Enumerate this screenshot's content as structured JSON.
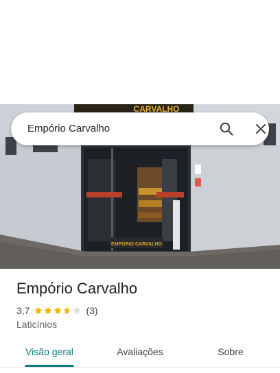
{
  "search": {
    "query": "Empório Carvalho"
  },
  "icons": {
    "search": "search-icon",
    "close": "close-icon"
  },
  "photo": {
    "sign_text": "CARVALHO",
    "doormat_text": "EMPÓRIO CARVALHO"
  },
  "place": {
    "name": "Empório Carvalho",
    "rating": "3,7",
    "rating_value": 3.7,
    "rating_max": 5,
    "review_count": "(3)",
    "category": "Laticínios"
  },
  "tabs": [
    {
      "label": "Visão geral",
      "active": true
    },
    {
      "label": "Avaliações",
      "active": false
    },
    {
      "label": "Sobre",
      "active": false
    }
  ],
  "colors": {
    "accent": "#0b7a7a",
    "star": "#f4b400",
    "star_empty": "#dadce0"
  }
}
